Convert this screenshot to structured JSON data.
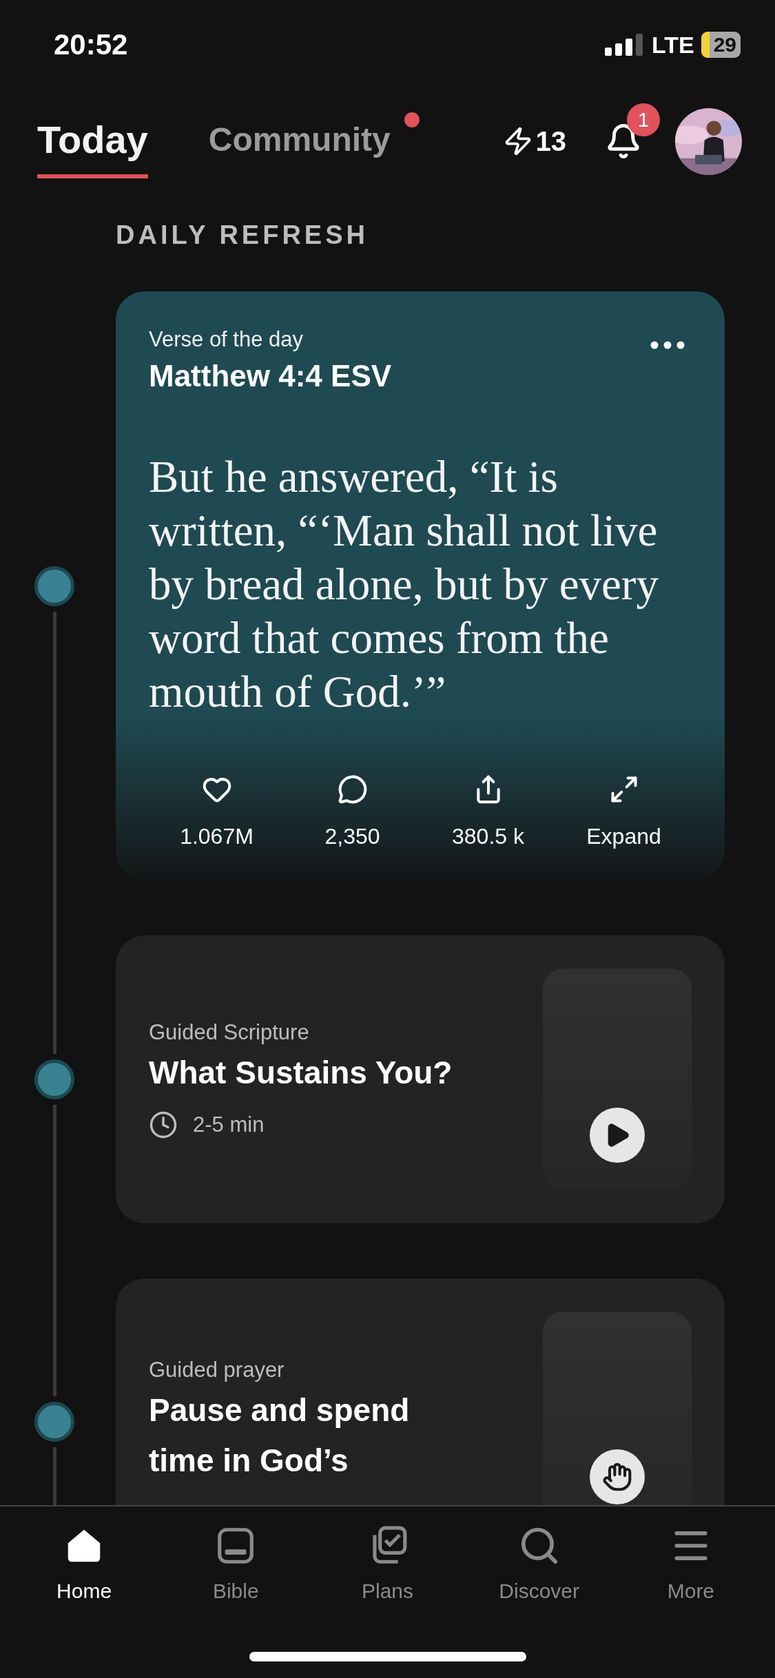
{
  "status_bar": {
    "time": "20:52",
    "network": "LTE",
    "battery": "29"
  },
  "tabs": [
    {
      "label": "Today",
      "selected": true,
      "dot": false
    },
    {
      "label": "Community",
      "selected": false,
      "dot": true
    }
  ],
  "streak": "13",
  "notifications": "1",
  "section_title": "DAILY REFRESH",
  "verse_card": {
    "label": "Verse of the day",
    "reference": "Matthew 4:4 ESV",
    "text": "But he answered, “It is written, “‘Man shall not live by bread alone, but by every word that comes from the mouth of God.’”",
    "actions": [
      {
        "kind": "like",
        "label": "1.067M"
      },
      {
        "kind": "comment",
        "label": "2,350"
      },
      {
        "kind": "share",
        "label": "380.5 k"
      },
      {
        "kind": "expand",
        "label": "Expand"
      }
    ]
  },
  "cards": [
    {
      "kind": "play",
      "label": "Guided Scripture",
      "title": "What Sustains You?",
      "duration": "2-5 min"
    },
    {
      "kind": "prayer",
      "label": "Guided prayer",
      "title": "Pause and spend time in God’s"
    }
  ],
  "nav": [
    {
      "kind": "home",
      "label": "Home",
      "selected": true
    },
    {
      "kind": "bible",
      "label": "Bible",
      "selected": false
    },
    {
      "kind": "plans",
      "label": "Plans",
      "selected": false
    },
    {
      "kind": "discover",
      "label": "Discover",
      "selected": false
    },
    {
      "kind": "more",
      "label": "More",
      "selected": false
    }
  ]
}
